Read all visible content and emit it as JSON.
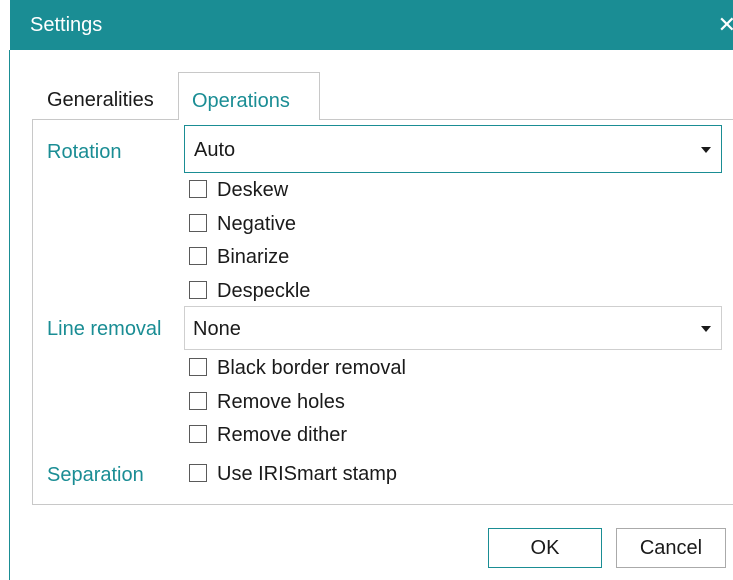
{
  "window": {
    "title": "Settings",
    "close_glyph": "✕"
  },
  "tabs": [
    {
      "label": "Generalities",
      "active": false
    },
    {
      "label": "Operations",
      "active": true
    }
  ],
  "rotation": {
    "label": "Rotation",
    "value": "Auto"
  },
  "image_options": [
    {
      "label": "Deskew",
      "checked": false
    },
    {
      "label": "Negative",
      "checked": false
    },
    {
      "label": "Binarize",
      "checked": false
    },
    {
      "label": "Despeckle",
      "checked": false
    }
  ],
  "line_removal": {
    "label": "Line removal",
    "value": "None"
  },
  "line_options": [
    {
      "label": "Black border removal",
      "checked": false
    },
    {
      "label": "Remove holes",
      "checked": false
    },
    {
      "label": "Remove dither",
      "checked": false
    }
  ],
  "separation": {
    "label": "Separation",
    "option": {
      "label": "Use IRISmart stamp",
      "checked": false
    }
  },
  "buttons": {
    "ok": "OK",
    "cancel": "Cancel"
  },
  "colors": {
    "accent": "#1a8d94",
    "title_text": "#ffffff"
  },
  "icons": {
    "close": "close-icon",
    "dropdown": "chevron-down-icon",
    "checkbox": "checkbox-icon"
  }
}
